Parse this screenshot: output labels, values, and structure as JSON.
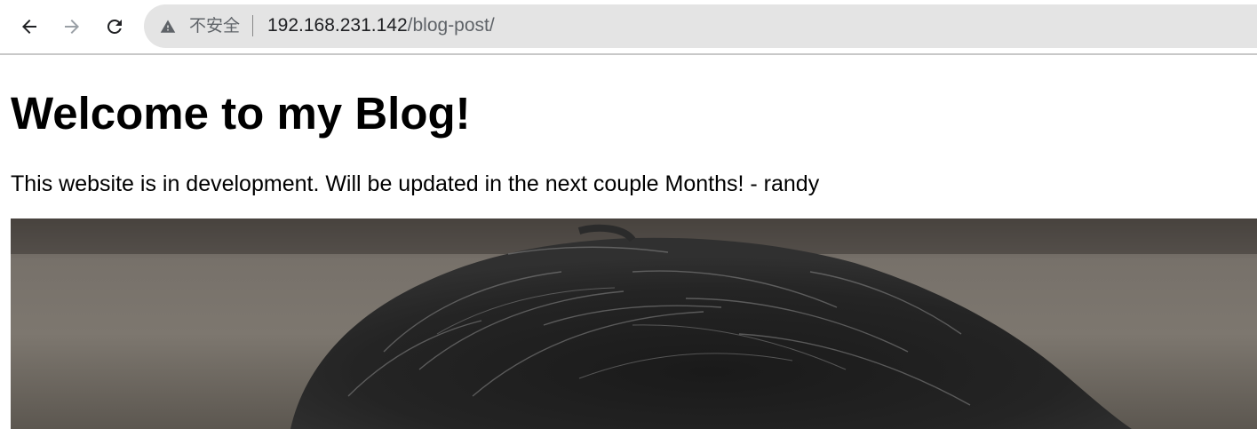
{
  "browser": {
    "security_label": "不安全",
    "url_host": "192.168.231.142",
    "url_path": "/blog-post/"
  },
  "page": {
    "title": "Welcome to my Blog!",
    "intro": "This website is in development. Will be updated in the next couple Months! - randy"
  },
  "colors": {
    "omnibox_bg": "#e4e4e4",
    "text": "#000000",
    "url_path": "#5f6368"
  }
}
